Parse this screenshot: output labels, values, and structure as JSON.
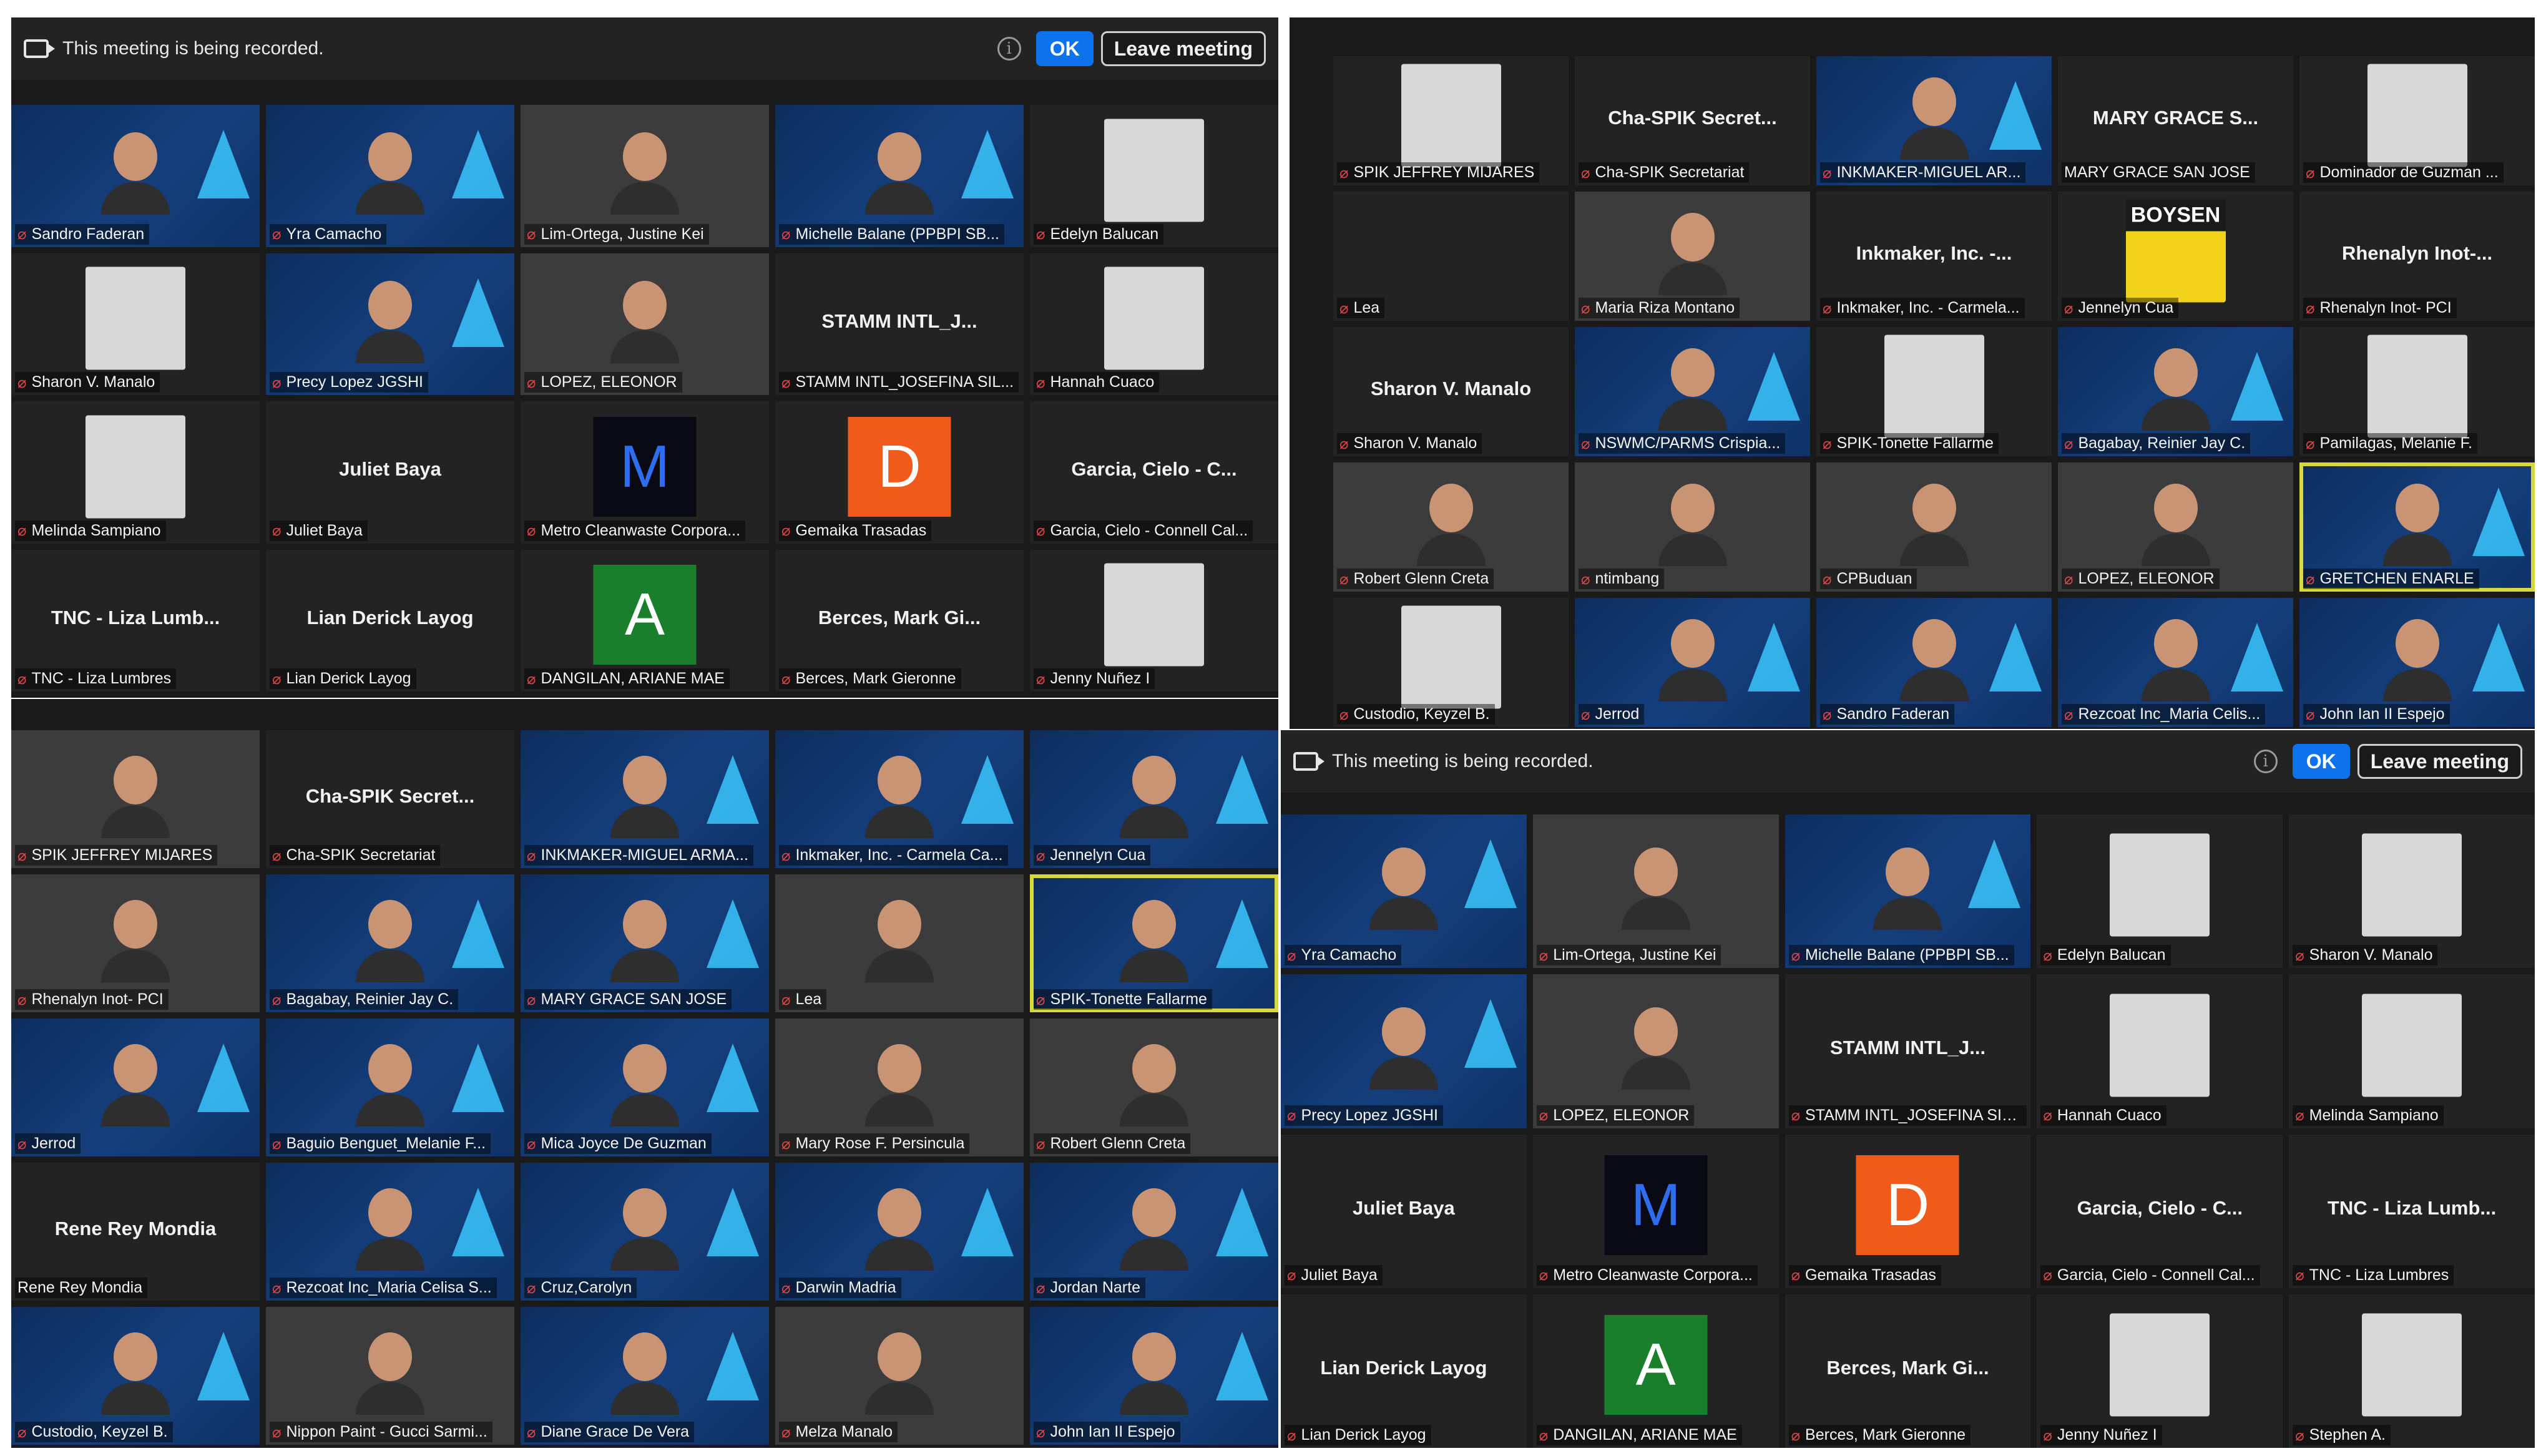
{
  "recording_bar": {
    "text": "This meeting is being recorded.",
    "ok": "OK",
    "leave": "Leave meeting",
    "info": "i"
  },
  "colors": {
    "gemaika_badge": "#f05a1a",
    "dangilan_badge": "#1a7f2c",
    "metro_badge": "#0a0a14",
    "accent_blue": "#0e72ed",
    "active_border": "#d8d83a"
  },
  "panel_a": [
    {
      "type": "cam",
      "label": "Sandro Faderan"
    },
    {
      "type": "cam",
      "label": "Yra Camacho"
    },
    {
      "type": "img",
      "label": "Lim-Ortega, Justine Kei"
    },
    {
      "type": "cam",
      "label": "Michelle Balane (PPBPI SB..."
    },
    {
      "type": "pic",
      "label": "Edelyn Balucan"
    },
    {
      "type": "pic",
      "label": "Sharon V. Manalo"
    },
    {
      "type": "cam",
      "label": "Precy Lopez JGSHI"
    },
    {
      "type": "img",
      "label": "LOPEZ, ELEONOR"
    },
    {
      "type": "name",
      "name": "STAMM INTL_J...",
      "label": "STAMM INTL_JOSEFINA SIL..."
    },
    {
      "type": "pic",
      "label": "Hannah Cuaco"
    },
    {
      "type": "pic",
      "label": "Melinda Sampiano"
    },
    {
      "type": "name",
      "name": "Juliet Baya",
      "label": "Juliet Baya"
    },
    {
      "type": "letter",
      "letter": "M",
      "color": "metro_badge",
      "label": "Metro Cleanwaste Corpora..."
    },
    {
      "type": "letter",
      "letter": "D",
      "color": "gemaika_badge",
      "label": "Gemaika Trasadas"
    },
    {
      "type": "name",
      "name": "Garcia, Cielo - C...",
      "label": "Garcia, Cielo - Connell Cal..."
    },
    {
      "type": "name",
      "name": "TNC - Liza Lumb...",
      "label": "TNC - Liza Lumbres"
    },
    {
      "type": "name",
      "name": "Lian Derick Layog",
      "label": "Lian Derick Layog"
    },
    {
      "type": "letter",
      "letter": "A",
      "color": "dangilan_badge",
      "label": "DANGILAN, ARIANE MAE"
    },
    {
      "type": "name",
      "name": "Berces, Mark Gi...",
      "label": "Berces, Mark Gieronne"
    },
    {
      "type": "pic",
      "label": "Jenny Nuñez I"
    }
  ],
  "panel_b": [
    {
      "type": "img",
      "label": "SPIK JEFFREY MIJARES"
    },
    {
      "type": "name",
      "name": "Cha-SPIK Secret...",
      "label": "Cha-SPIK Secretariat"
    },
    {
      "type": "cam",
      "label": "INKMAKER-MIGUEL ARMA..."
    },
    {
      "type": "cam",
      "label": "Inkmaker, Inc. - Carmela Ca..."
    },
    {
      "type": "cam",
      "label": "Jennelyn Cua"
    },
    {
      "type": "img",
      "label": "Rhenalyn Inot- PCI"
    },
    {
      "type": "cam",
      "label": "Bagabay, Reinier Jay C."
    },
    {
      "type": "cam",
      "label": "MARY GRACE SAN JOSE"
    },
    {
      "type": "img",
      "label": "Lea"
    },
    {
      "type": "cam",
      "label": "SPIK-Tonette Fallarme",
      "active": true
    },
    {
      "type": "cam",
      "label": "Jerrod"
    },
    {
      "type": "cam",
      "label": "Baguio Benguet_Melanie F..."
    },
    {
      "type": "cam",
      "label": "Mica Joyce De Guzman"
    },
    {
      "type": "img",
      "label": "Mary Rose F. Persincula"
    },
    {
      "type": "img",
      "label": "Robert Glenn Creta"
    },
    {
      "type": "name",
      "name": "Rene Rey Mondia",
      "label": "Rene Rey Mondia",
      "nomic": true
    },
    {
      "type": "cam",
      "label": "Rezcoat Inc_Maria Celisa S..."
    },
    {
      "type": "cam",
      "label": "Cruz,Carolyn"
    },
    {
      "type": "cam",
      "label": "Darwin Madria"
    },
    {
      "type": "cam",
      "label": "Jordan Narte"
    },
    {
      "type": "cam",
      "label": "Custodio, Keyzel B."
    },
    {
      "type": "img",
      "label": "Nippon Paint - Gucci Sarmi..."
    },
    {
      "type": "cam",
      "label": "Diane Grace De Vera"
    },
    {
      "type": "img",
      "label": "Melza Manalo"
    },
    {
      "type": "cam",
      "label": "John Ian II Espejo"
    }
  ],
  "panel_c": [
    {
      "type": "pic",
      "label": "SPIK JEFFREY MIJARES"
    },
    {
      "type": "name",
      "name": "Cha-SPIK Secret...",
      "label": "Cha-SPIK Secretariat"
    },
    {
      "type": "cam",
      "label": "INKMAKER-MIGUEL AR..."
    },
    {
      "type": "name",
      "name": "MARY GRACE S...",
      "label": "MARY GRACE SAN JOSE",
      "nomic": true
    },
    {
      "type": "pic",
      "label": "Dominador de Guzman ..."
    },
    {
      "type": "name",
      "name": "",
      "label": "Lea"
    },
    {
      "type": "img",
      "label": "Maria Riza Montano"
    },
    {
      "type": "name",
      "name": "Inkmaker, Inc. -...",
      "label": "Inkmaker, Inc. - Carmela..."
    },
    {
      "type": "pic",
      "logo": "BOYSEN",
      "label": "Jennelyn Cua"
    },
    {
      "type": "name",
      "name": "Rhenalyn Inot-...",
      "label": "Rhenalyn Inot- PCI"
    },
    {
      "type": "name",
      "name": "Sharon V. Manalo",
      "label": "Sharon V. Manalo"
    },
    {
      "type": "cam",
      "label": "NSWMC/PARMS Crispia..."
    },
    {
      "type": "pic",
      "label": "SPIK-Tonette Fallarme"
    },
    {
      "type": "cam",
      "label": "Bagabay, Reinier Jay C."
    },
    {
      "type": "pic",
      "label": "Pamilagas, Melanie F."
    },
    {
      "type": "img",
      "label": "Robert Glenn Creta"
    },
    {
      "type": "img",
      "label": "ntimbang"
    },
    {
      "type": "img",
      "label": "CPBuduan"
    },
    {
      "type": "img",
      "label": "LOPEZ, ELEONOR"
    },
    {
      "type": "cam",
      "label": "GRETCHEN ENARLE",
      "active": true
    },
    {
      "type": "pic",
      "label": "Custodio, Keyzel B."
    },
    {
      "type": "cam",
      "label": "Jerrod"
    },
    {
      "type": "cam",
      "label": "Sandro Faderan"
    },
    {
      "type": "cam",
      "label": "Rezcoat Inc_Maria Celis..."
    },
    {
      "type": "cam",
      "label": "John Ian II Espejo"
    }
  ],
  "panel_d": [
    {
      "type": "cam",
      "label": "Yra Camacho"
    },
    {
      "type": "img",
      "label": "Lim-Ortega, Justine Kei"
    },
    {
      "type": "cam",
      "label": "Michelle Balane (PPBPI SB..."
    },
    {
      "type": "pic",
      "label": "Edelyn Balucan"
    },
    {
      "type": "pic",
      "label": "Sharon V. Manalo"
    },
    {
      "type": "cam",
      "label": "Precy Lopez JGSHI"
    },
    {
      "type": "img",
      "label": "LOPEZ, ELEONOR"
    },
    {
      "type": "name",
      "name": "STAMM INTL_J...",
      "label": "STAMM INTL_JOSEFINA SIL..."
    },
    {
      "type": "pic",
      "label": "Hannah Cuaco"
    },
    {
      "type": "pic",
      "label": "Melinda Sampiano"
    },
    {
      "type": "name",
      "name": "Juliet Baya",
      "label": "Juliet Baya"
    },
    {
      "type": "letter",
      "letter": "M",
      "color": "metro_badge",
      "label": "Metro Cleanwaste Corpora..."
    },
    {
      "type": "letter",
      "letter": "D",
      "color": "gemaika_badge",
      "label": "Gemaika Trasadas"
    },
    {
      "type": "name",
      "name": "Garcia, Cielo - C...",
      "label": "Garcia, Cielo - Connell Cal..."
    },
    {
      "type": "name",
      "name": "TNC - Liza Lumb...",
      "label": "TNC - Liza Lumbres"
    },
    {
      "type": "name",
      "name": "Lian Derick Layog",
      "label": "Lian Derick Layog"
    },
    {
      "type": "letter",
      "letter": "A",
      "color": "dangilan_badge",
      "label": "DANGILAN, ARIANE MAE"
    },
    {
      "type": "name",
      "name": "Berces, Mark Gi...",
      "label": "Berces, Mark Gieronne"
    },
    {
      "type": "pic",
      "label": "Jenny Nuñez I"
    },
    {
      "type": "pic",
      "label": "Stephen A."
    }
  ]
}
